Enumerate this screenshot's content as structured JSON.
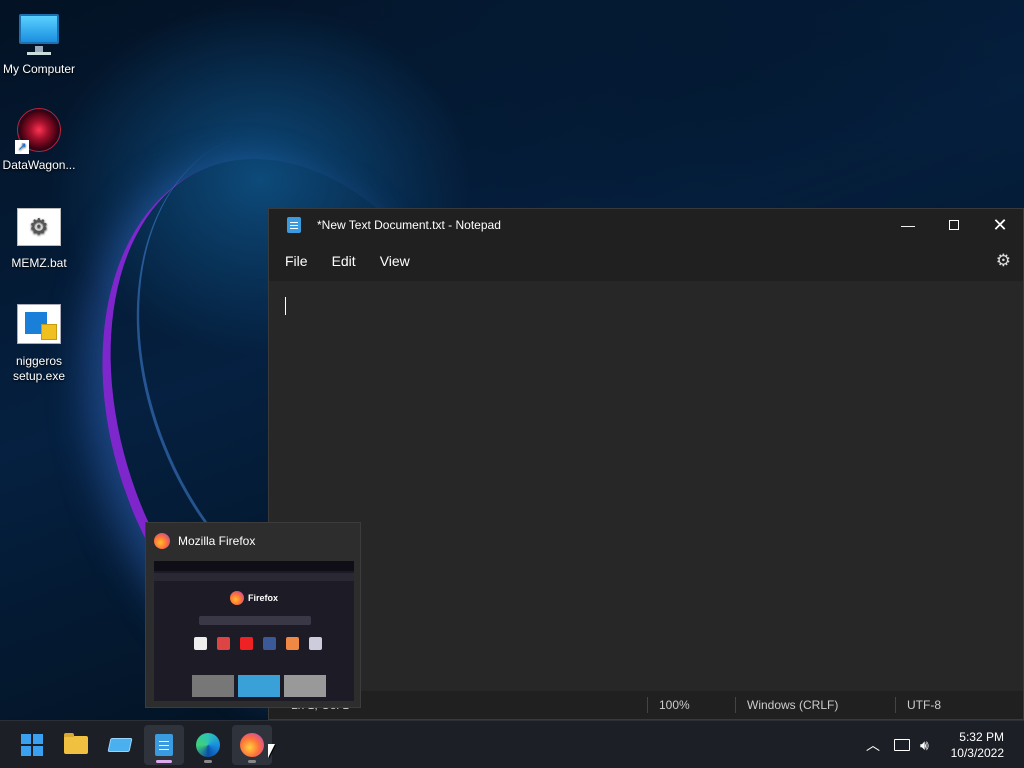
{
  "desktop": {
    "icons": [
      {
        "label": "My Computer",
        "icon": "computer-icon"
      },
      {
        "label": "DataWagon...",
        "icon": "datawagon-icon"
      },
      {
        "label": "MEMZ.bat",
        "icon": "batch-file-icon"
      },
      {
        "label": "niggeros setup.exe",
        "icon": "setup-exe-icon"
      }
    ]
  },
  "notepad": {
    "title": "*New Text Document.txt - Notepad",
    "menu": [
      "File",
      "Edit",
      "View"
    ],
    "content": "",
    "status": {
      "position": "Ln 1, Col 1",
      "zoom": "100%",
      "line_ending": "Windows (CRLF)",
      "encoding": "UTF-8"
    }
  },
  "firefox_preview": {
    "title": "Mozilla Firefox",
    "brand": "Firefox"
  },
  "taskbar": {
    "apps": [
      "Start",
      "File Explorer",
      "Drive",
      "Notepad",
      "Microsoft Edge",
      "Firefox"
    ],
    "clock": {
      "time": "5:32 PM",
      "date": "10/3/2022"
    }
  },
  "colors": {
    "accent": "#3aa0f0",
    "window_bg": "#2b2b2b",
    "titlebar_bg": "#202020",
    "taskbar_bg": "#1c2026"
  }
}
